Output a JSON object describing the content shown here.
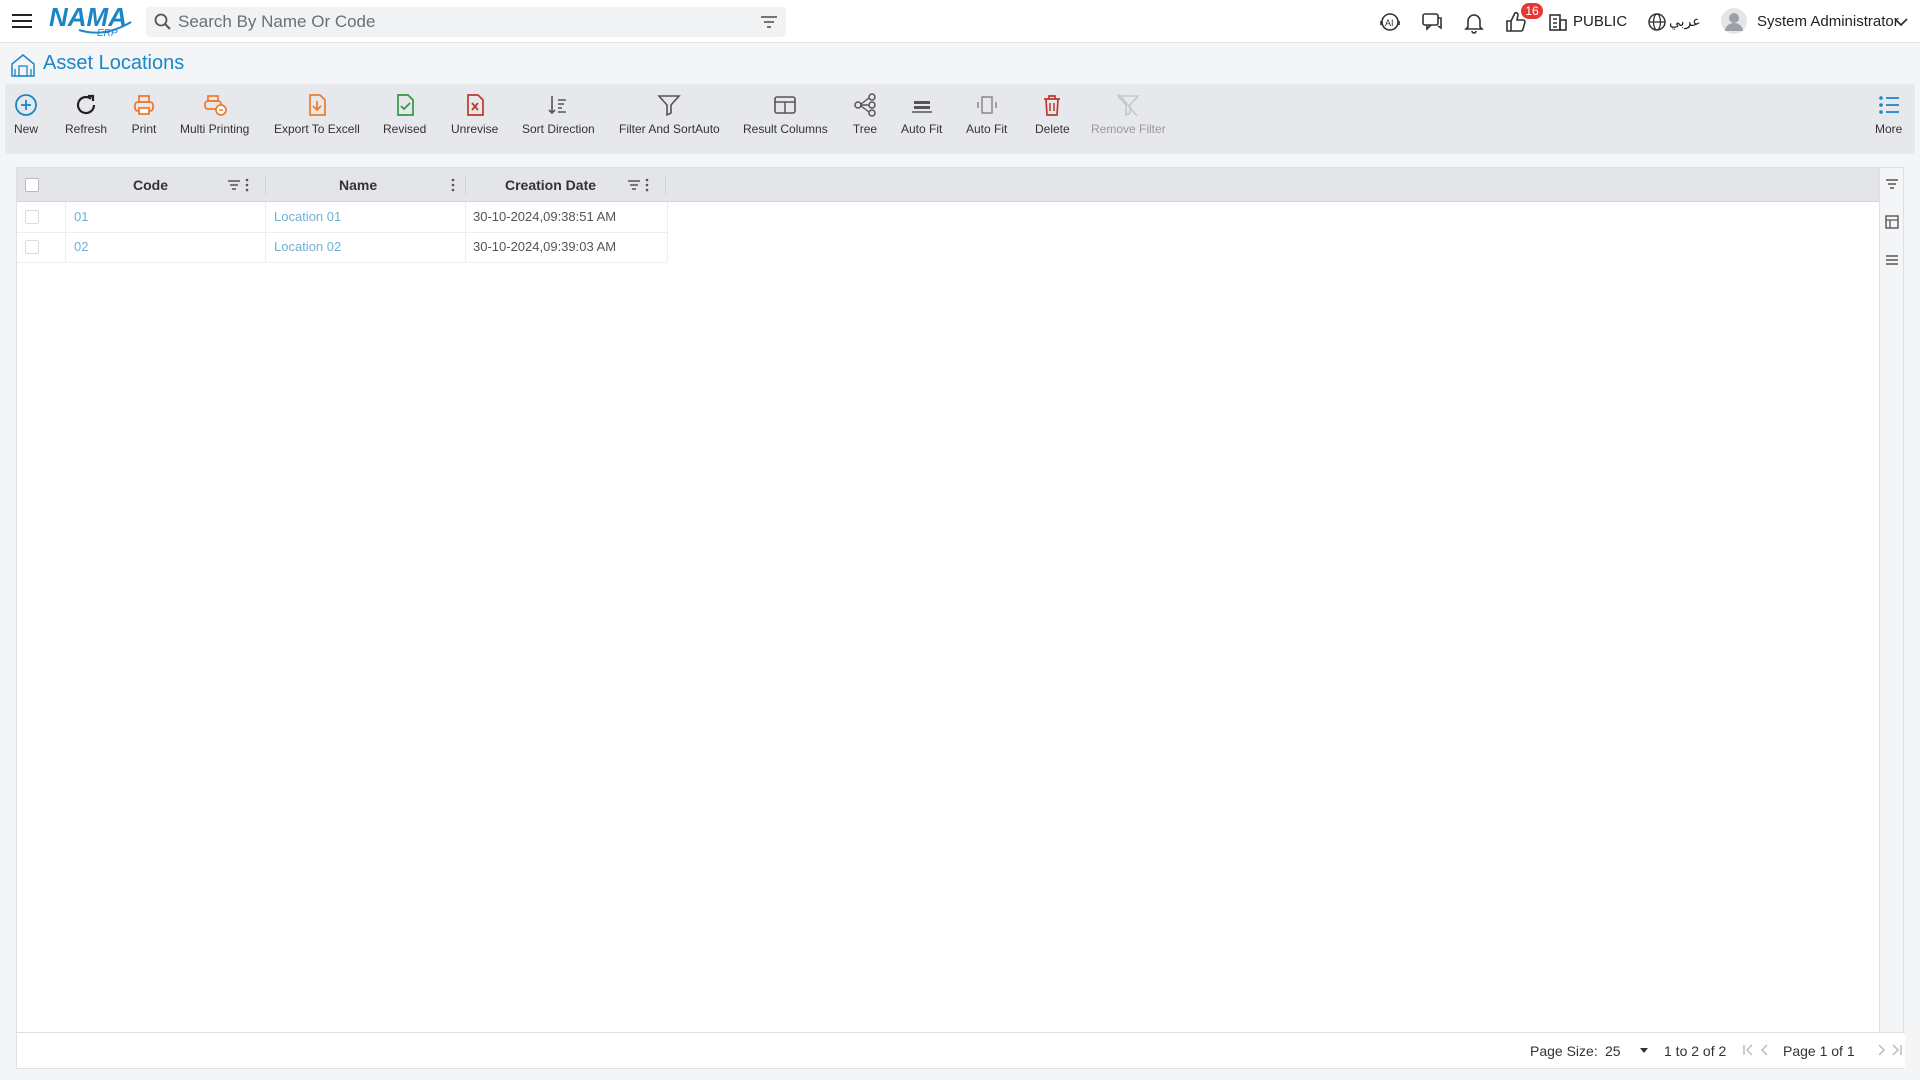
{
  "header": {
    "logo_text": "NAMA",
    "logo_sub": "ERP",
    "search_placeholder": "Search By Name Or Code",
    "badge_count": "16",
    "branch": "PUBLIC",
    "language": "عربي",
    "user_name": "System Administrator"
  },
  "page": {
    "title": "Asset Locations"
  },
  "toolbar": {
    "new": "New",
    "refresh": "Refresh",
    "print": "Print",
    "multi_printing": "Multi Printing",
    "export_excel": "Export To Excell",
    "revised": "Revised",
    "unrevise": "Unrevise",
    "sort_direction": "Sort Direction",
    "filter_sort_auto": "Filter And SortAuto",
    "result_columns": "Result Columns",
    "tree": "Tree",
    "auto_fit_1": "Auto Fit",
    "auto_fit_2": "Auto Fit",
    "delete": "Delete",
    "remove_filter": "Remove Filter",
    "more": "More"
  },
  "grid": {
    "columns": {
      "code": "Code",
      "name": "Name",
      "creation_date": "Creation Date"
    },
    "rows": [
      {
        "code": "01",
        "name": "Location 01",
        "creation_date": "30-10-2024,09:38:51 AM"
      },
      {
        "code": "02",
        "name": "Location 02",
        "creation_date": "30-10-2024,09:39:03 AM"
      }
    ]
  },
  "footer": {
    "page_size_label": "Page Size:",
    "page_size_value": "25",
    "range": "1 to 2 of 2",
    "page_label": "Page 1 of 1"
  },
  "colors": {
    "accent": "#1a86c7",
    "badge": "#e53935",
    "link_text": "#6fb1d6"
  }
}
